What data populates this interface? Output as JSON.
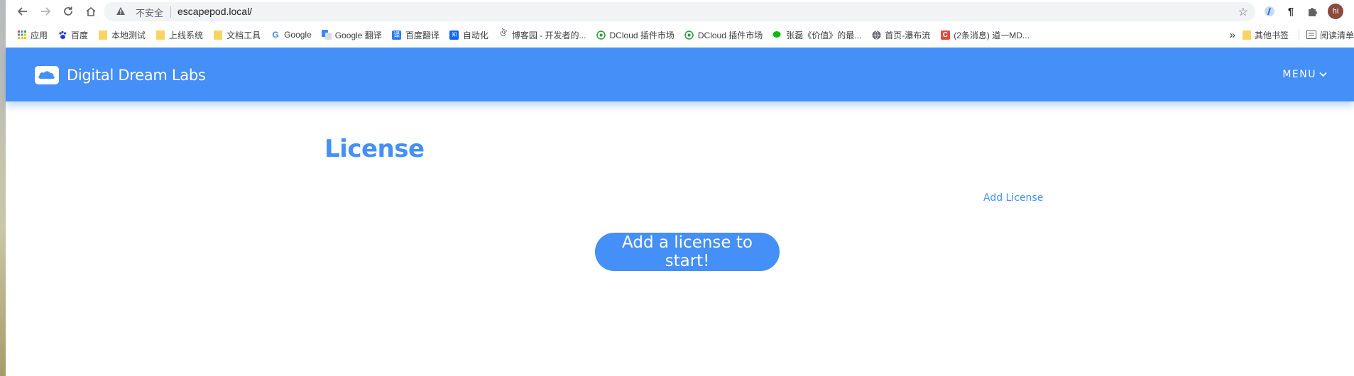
{
  "browser": {
    "insecure_label": "不安全",
    "url": "escapepod.local/",
    "profile_initial": "hi",
    "bookmarks": [
      {
        "label": "应用",
        "icon": "apps-grid-icon"
      },
      {
        "label": "百度",
        "icon": "baidu-paw-icon"
      },
      {
        "label": "本地测试",
        "icon": "folder-icon"
      },
      {
        "label": "上线系统",
        "icon": "folder-icon"
      },
      {
        "label": "文档工具",
        "icon": "folder-icon"
      },
      {
        "label": "Google",
        "icon": "google-g-icon"
      },
      {
        "label": "Google 翻译",
        "icon": "google-translate-icon"
      },
      {
        "label": "百度翻译",
        "icon": "baidu-translate-icon"
      },
      {
        "label": "自动化",
        "icon": "zhihu-icon"
      },
      {
        "label": "博客园 - 开发者的...",
        "icon": "cnblogs-icon"
      },
      {
        "label": "DCloud 插件市场",
        "icon": "dcloud-icon"
      },
      {
        "label": "DCloud 插件市场",
        "icon": "dcloud-icon"
      },
      {
        "label": "张磊《价值》的最...",
        "icon": "wechat-icon"
      },
      {
        "label": "首页-瀑布流",
        "icon": "globe-icon"
      },
      {
        "label": "(2条消息) 道一MD...",
        "icon": "csdn-icon"
      }
    ],
    "overflow_label": "»",
    "other_bookmarks": "其他书签",
    "reading_list": "阅读清单"
  },
  "navbar": {
    "brand": "Digital Dream Labs",
    "menu": "MENU"
  },
  "main": {
    "title": "License",
    "add_link": "Add License",
    "cta": "Add a license to start!"
  },
  "colors": {
    "accent": "#448ff8",
    "folder": "#f9d465"
  }
}
